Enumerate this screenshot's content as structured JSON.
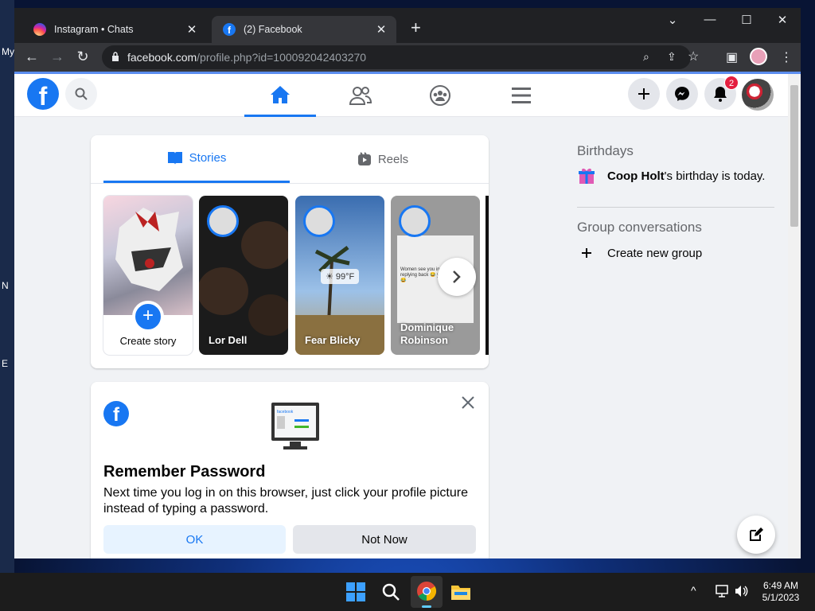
{
  "desktop": {
    "labels": [
      "My",
      "N",
      "E"
    ]
  },
  "browser": {
    "tabs": [
      {
        "title": "Instagram • Chats",
        "close": "✕"
      },
      {
        "title": "(2) Facebook",
        "close": "✕"
      }
    ],
    "new_tab": "+",
    "window_controls": {
      "dropdown": "⌄",
      "minimize": "—",
      "maximize": "☐",
      "close": "✕"
    },
    "url_host": "facebook.com",
    "url_path": "/profile.php?id=100092042403270",
    "icons": {
      "back": "←",
      "forward": "→",
      "reload": "↻",
      "zoom": "⌕",
      "share": "⇪",
      "bookmark": "☆",
      "sidebar": "▣",
      "menu": "⋮"
    }
  },
  "facebook": {
    "logo_letter": "f",
    "notifications_count": "2",
    "stories": {
      "tabs": [
        {
          "label": "Stories"
        },
        {
          "label": "Reels"
        }
      ],
      "cards": [
        {
          "name": "Create story"
        },
        {
          "name": "Lor Dell"
        },
        {
          "name": "Fear Blicky",
          "weather": "☀ 99°F"
        },
        {
          "name": "Dominique Robinson",
          "caption": "Women see you in person replying back 😂 you're broke 😂"
        }
      ]
    },
    "remember_password": {
      "title": "Remember Password",
      "text": "Next time you log in on this browser, just click your profile picture instead of typing a password.",
      "ok_label": "OK",
      "not_now_label": "Not Now",
      "screen_brand": "facebook"
    },
    "right_rail": {
      "birthdays_heading": "Birthdays",
      "birthday_name": "Coop Holt",
      "birthday_text": "'s birthday is today.",
      "group_heading": "Group conversations",
      "create_group": "Create new group"
    }
  },
  "taskbar": {
    "time": "6:49 AM",
    "date": "5/1/2023",
    "tray_up": "^"
  }
}
